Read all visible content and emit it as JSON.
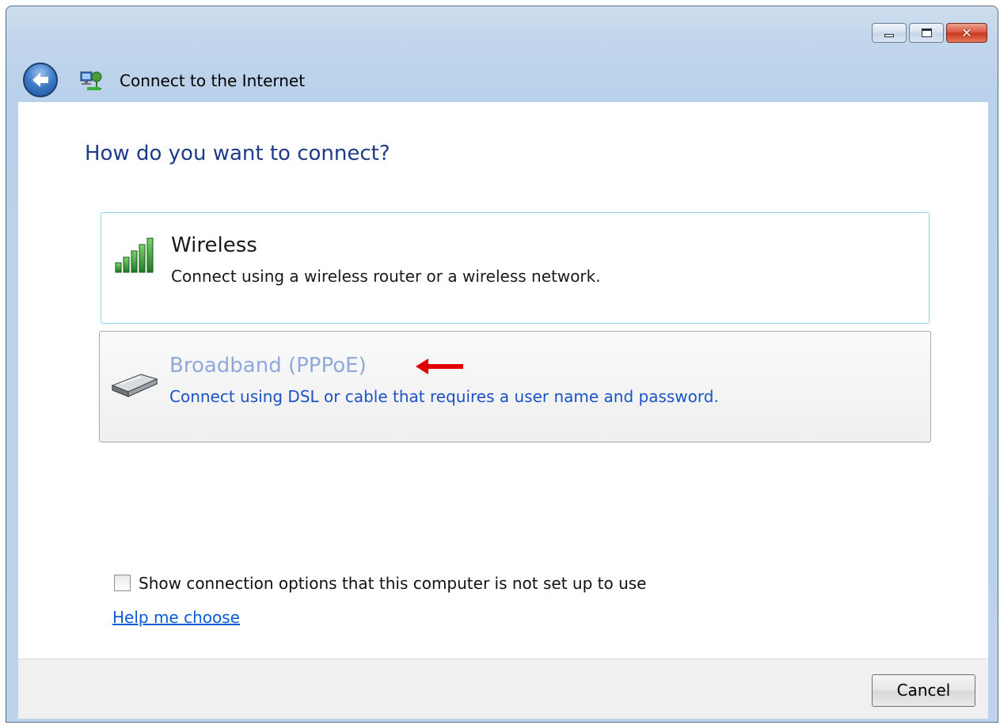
{
  "window": {
    "title": "Connect to the Internet",
    "caption_buttons": {
      "close_glyph": "✕"
    }
  },
  "main": {
    "heading": "How do you want to connect?",
    "options": [
      {
        "title": "Wireless",
        "description": "Connect using a wireless router or a wireless network.",
        "icon": "wireless-signal-icon"
      },
      {
        "title": "Broadband (PPPoE)",
        "description": "Connect using DSL or cable that requires a user name and password.",
        "icon": "broadband-modem-icon",
        "state": "hovered"
      }
    ],
    "show_options_checkbox": {
      "label": "Show connection options that this computer is not set up to use",
      "checked": false
    },
    "help_link": "Help me choose"
  },
  "footer": {
    "cancel_label": "Cancel"
  },
  "colors": {
    "heading": "#1e3b8a",
    "link": "#0b5bd6",
    "annotation_arrow": "#e00000"
  }
}
